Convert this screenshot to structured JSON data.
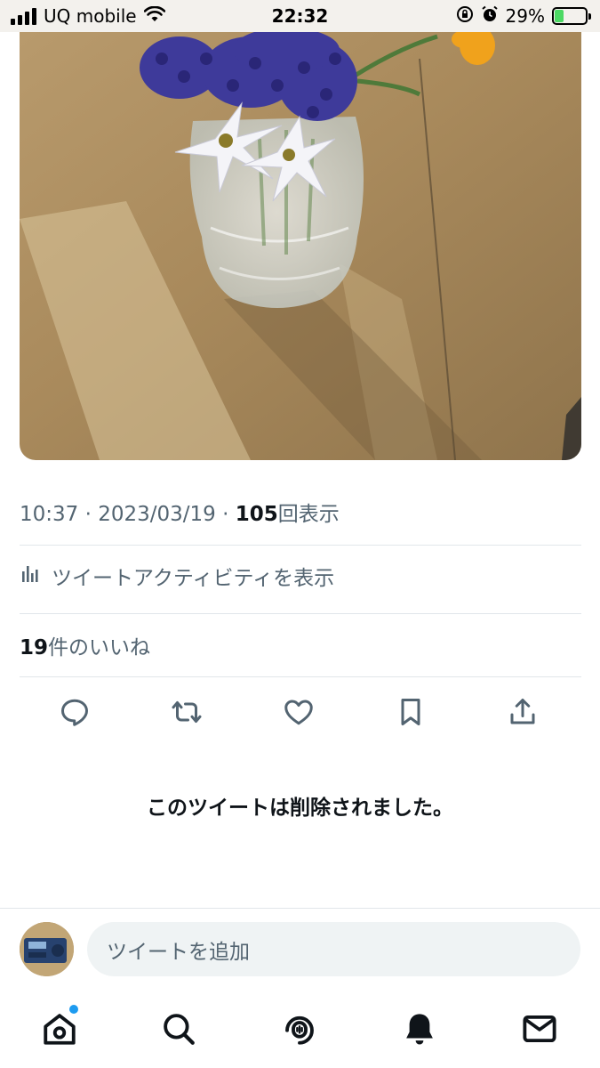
{
  "status_bar": {
    "carrier": "UQ mobile",
    "time": "22:32",
    "battery_percent": "29%",
    "battery_level": 0.29
  },
  "tweet": {
    "time": "10:37",
    "date": "2023/03/19",
    "views_count": "105",
    "views_label": "回表示",
    "activity_label": "ツイートアクティビティを表示",
    "likes_count": "19",
    "likes_label": "件のいいね",
    "deleted_notice": "このツイートは削除されました。"
  },
  "reply": {
    "placeholder": "ツイートを追加"
  },
  "icons": {
    "reply": "reply-icon",
    "retweet": "retweet-icon",
    "like": "heart-icon",
    "bookmark": "bookmark-icon",
    "share": "share-icon",
    "home": "home-icon",
    "search": "search-icon",
    "spaces": "spaces-icon",
    "notifications": "bell-icon",
    "messages": "mail-icon"
  },
  "colors": {
    "accent": "#1d9bf0",
    "secondary_text": "#536471",
    "primary_text": "#0f1419",
    "battery_green": "#4cd964"
  }
}
